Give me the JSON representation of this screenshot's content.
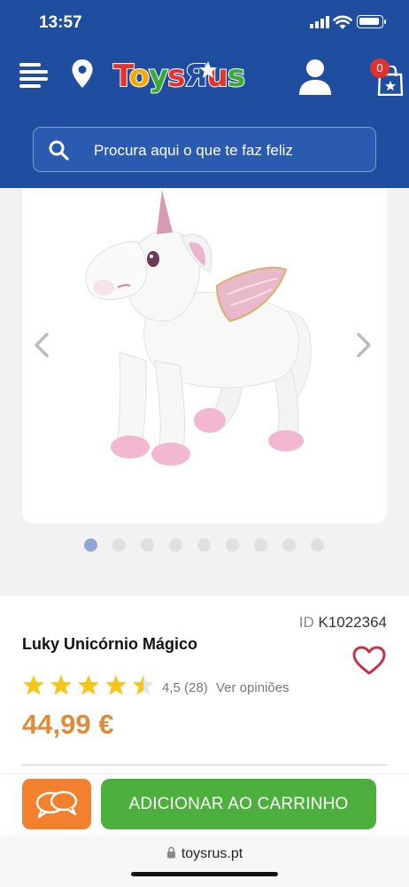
{
  "status_bar": {
    "time": "13:57"
  },
  "header": {
    "brand": "ToysRUs",
    "cart_count": "0",
    "search_placeholder": "Procura aqui o que te faz feliz"
  },
  "gallery": {
    "image_description": "Luky Unicórnio Mágico",
    "dot_count": 9,
    "active_index": 0
  },
  "product": {
    "id_label": "ID",
    "id_value": "K1022364",
    "name": "Luky Unicórnio Mágico",
    "rating": 4.5,
    "rating_text": "4,5 (28)",
    "reviews_link": "Ver opiniões",
    "price": "44,99 €"
  },
  "actions": {
    "add_to_cart": "ADICIONAR AO CARRINHO"
  },
  "browser": {
    "url": "toysrus.pt"
  },
  "colors": {
    "header_bg": "#1f4ea0",
    "price": "#e08b3a",
    "add_button": "#4caf3e",
    "chat_button": "#f2802f",
    "star": "#f5c518",
    "heart": "#c8314a"
  }
}
